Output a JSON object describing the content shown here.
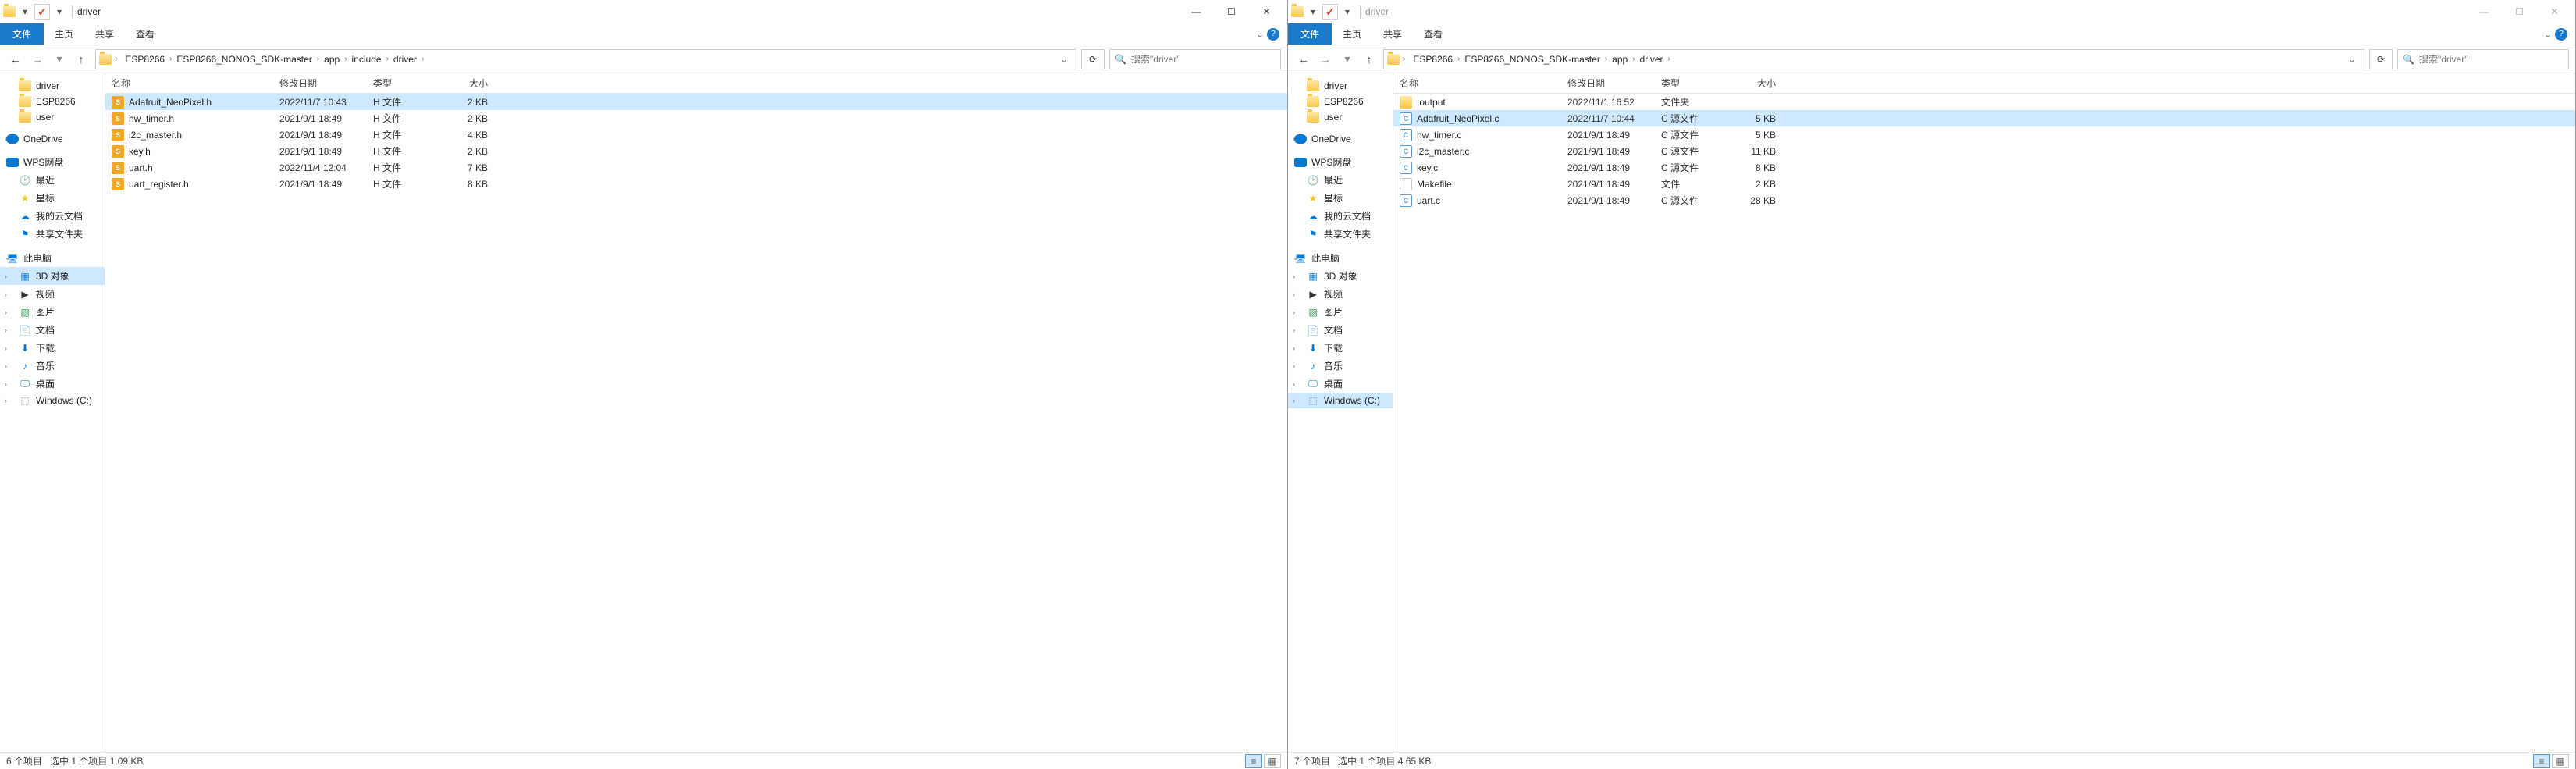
{
  "left": {
    "title": "driver",
    "tabs": {
      "file": "文件",
      "home": "主页",
      "share": "共享",
      "view": "查看"
    },
    "breadcrumbs": [
      "ESP8266",
      "ESP8266_NONOS_SDK-master",
      "app",
      "include",
      "driver"
    ],
    "search_placeholder": "搜索\"driver\"",
    "quick_folders": [
      {
        "label": "driver"
      },
      {
        "label": "ESP8266"
      },
      {
        "label": "user"
      }
    ],
    "onedrive": "OneDrive",
    "wps": "WPS网盘",
    "wps_children": [
      {
        "label": "最近",
        "icon": "🕑",
        "cls": ""
      },
      {
        "label": "星标",
        "icon": "★",
        "cls": "star-icon"
      },
      {
        "label": "我的云文档",
        "icon": "☁",
        "cls": "cloud-doc-icon"
      },
      {
        "label": "共享文件夹",
        "icon": "⚑",
        "cls": "share-icon"
      }
    ],
    "thispc": "此电脑",
    "thispc_children": [
      {
        "label": "3D 对象",
        "icon": "▦",
        "cls": "pc-icon",
        "selected": true
      },
      {
        "label": "视频",
        "icon": "▶",
        "cls": "video-icon"
      },
      {
        "label": "图片",
        "icon": "▧",
        "cls": "img-icon"
      },
      {
        "label": "文档",
        "icon": "📄",
        "cls": "doc-icon"
      },
      {
        "label": "下载",
        "icon": "⬇",
        "cls": "dl-icon"
      },
      {
        "label": "音乐",
        "icon": "♪",
        "cls": "music-icon"
      },
      {
        "label": "桌面",
        "icon": "🖵",
        "cls": "desktop-icon"
      },
      {
        "label": "Windows (C:)",
        "icon": "⬚",
        "cls": "disk-icon"
      }
    ],
    "columns": {
      "name": "名称",
      "date": "修改日期",
      "type": "类型",
      "size": "大小"
    },
    "files": [
      {
        "name": "Adafruit_NeoPixel.h",
        "date": "2022/11/7 10:43",
        "type": "H 文件",
        "size": "2 KB",
        "icon": "h",
        "selected": true
      },
      {
        "name": "hw_timer.h",
        "date": "2021/9/1 18:49",
        "type": "H 文件",
        "size": "2 KB",
        "icon": "h"
      },
      {
        "name": "i2c_master.h",
        "date": "2021/9/1 18:49",
        "type": "H 文件",
        "size": "4 KB",
        "icon": "h"
      },
      {
        "name": "key.h",
        "date": "2021/9/1 18:49",
        "type": "H 文件",
        "size": "2 KB",
        "icon": "h"
      },
      {
        "name": "uart.h",
        "date": "2022/11/4 12:04",
        "type": "H 文件",
        "size": "7 KB",
        "icon": "h"
      },
      {
        "name": "uart_register.h",
        "date": "2021/9/1 18:49",
        "type": "H 文件",
        "size": "8 KB",
        "icon": "h"
      }
    ],
    "status": {
      "count": "6 个项目",
      "selection": "选中 1 个项目 1.09 KB"
    }
  },
  "right": {
    "title": "driver",
    "tabs": {
      "file": "文件",
      "home": "主页",
      "share": "共享",
      "view": "查看"
    },
    "breadcrumbs": [
      "ESP8266",
      "ESP8266_NONOS_SDK-master",
      "app",
      "driver"
    ],
    "search_placeholder": "搜索\"driver\"",
    "quick_folders": [
      {
        "label": "driver"
      },
      {
        "label": "ESP8266"
      },
      {
        "label": "user"
      }
    ],
    "onedrive": "OneDrive",
    "wps": "WPS网盘",
    "wps_children": [
      {
        "label": "最近",
        "icon": "🕑",
        "cls": ""
      },
      {
        "label": "星标",
        "icon": "★",
        "cls": "star-icon"
      },
      {
        "label": "我的云文档",
        "icon": "☁",
        "cls": "cloud-doc-icon"
      },
      {
        "label": "共享文件夹",
        "icon": "⚑",
        "cls": "share-icon"
      }
    ],
    "thispc": "此电脑",
    "thispc_children": [
      {
        "label": "3D 对象",
        "icon": "▦",
        "cls": "pc-icon"
      },
      {
        "label": "视频",
        "icon": "▶",
        "cls": "video-icon"
      },
      {
        "label": "图片",
        "icon": "▧",
        "cls": "img-icon"
      },
      {
        "label": "文档",
        "icon": "📄",
        "cls": "doc-icon"
      },
      {
        "label": "下载",
        "icon": "⬇",
        "cls": "dl-icon"
      },
      {
        "label": "音乐",
        "icon": "♪",
        "cls": "music-icon"
      },
      {
        "label": "桌面",
        "icon": "🖵",
        "cls": "desktop-icon"
      },
      {
        "label": "Windows (C:)",
        "icon": "⬚",
        "cls": "disk-icon",
        "selected": true
      }
    ],
    "columns": {
      "name": "名称",
      "date": "修改日期",
      "type": "类型",
      "size": "大小"
    },
    "files": [
      {
        "name": ".output",
        "date": "2022/11/1 16:52",
        "type": "文件夹",
        "size": "",
        "icon": "folder"
      },
      {
        "name": "Adafruit_NeoPixel.c",
        "date": "2022/11/7 10:44",
        "type": "C 源文件",
        "size": "5 KB",
        "icon": "c",
        "selected": true
      },
      {
        "name": "hw_timer.c",
        "date": "2021/9/1 18:49",
        "type": "C 源文件",
        "size": "5 KB",
        "icon": "c"
      },
      {
        "name": "i2c_master.c",
        "date": "2021/9/1 18:49",
        "type": "C 源文件",
        "size": "11 KB",
        "icon": "c"
      },
      {
        "name": "key.c",
        "date": "2021/9/1 18:49",
        "type": "C 源文件",
        "size": "8 KB",
        "icon": "c"
      },
      {
        "name": "Makefile",
        "date": "2021/9/1 18:49",
        "type": "文件",
        "size": "2 KB",
        "icon": "plain"
      },
      {
        "name": "uart.c",
        "date": "2021/9/1 18:49",
        "type": "C 源文件",
        "size": "28 KB",
        "icon": "c"
      }
    ],
    "status": {
      "count": "7 个项目",
      "selection": "选中 1 个项目 4.65 KB"
    }
  }
}
